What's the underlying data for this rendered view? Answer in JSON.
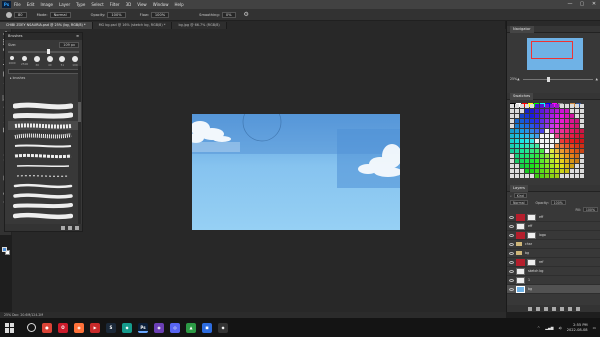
{
  "app": {
    "menu": [
      "File",
      "Edit",
      "Image",
      "Layer",
      "Type",
      "Select",
      "Filter",
      "3D",
      "View",
      "Window",
      "Help"
    ],
    "window_controls": [
      "—",
      "▢",
      "✕"
    ]
  },
  "options_bar": {
    "brush_size": "80",
    "mode_label": "Mode:",
    "mode_value": "Normal",
    "opacity_label": "Opacity:",
    "opacity_value": "100%",
    "flow_label": "Flow:",
    "flow_value": "100%",
    "smoothing_label": "Smoothing:",
    "smoothing_value": "0%"
  },
  "tabs": [
    {
      "label": "CHIBI ZOEY NSAURIA.psd @ 25% (bg, RGB/8) *",
      "active": true
    },
    {
      "label": "MG bg.psd @ 16% (sketch bg, RGB/8) *",
      "active": false
    },
    {
      "label": "bg.jpg @ 66.7% (RGB/8)",
      "active": false
    }
  ],
  "brushes_panel": {
    "title": "Brushes",
    "size_label": "Size:",
    "size_value": "109 px",
    "tips": [
      "1000",
      "2500",
      "30",
      "40",
      "51",
      "100"
    ],
    "group_label": "brushes",
    "selected_index": 2
  },
  "navigator": {
    "title": "Navigator",
    "zoom": "25%"
  },
  "swatches": {
    "title": "Swatches",
    "strip": [
      "#000000",
      "#ffffff",
      "#ff0000",
      "#ffff00",
      "#00ff00",
      "#00ffff",
      "#0000ff",
      "#ff00ff",
      "#888888",
      "#444444",
      "#cc8844",
      "#335599"
    ]
  },
  "layers": {
    "title": "Layers",
    "kind_label": "Kind",
    "blend_mode": "Normal",
    "opacity_label": "Opacity:",
    "opacity_value": "100%",
    "fill_label": "Fill:",
    "fill_value": "100%",
    "items": [
      {
        "name": "eff",
        "thumb": "white",
        "red": true,
        "visible": true,
        "active": false
      },
      {
        "name": "eff",
        "thumb": "white",
        "red": false,
        "visible": true,
        "active": false
      },
      {
        "name": "logo",
        "thumb": "white",
        "red": true,
        "visible": true,
        "active": false
      },
      {
        "name": "char",
        "thumb": "folder",
        "red": false,
        "visible": true,
        "active": false
      },
      {
        "name": "bg",
        "thumb": "folder",
        "red": false,
        "visible": true,
        "active": false
      },
      {
        "name": "ref",
        "thumb": "white",
        "red": true,
        "visible": true,
        "active": false
      },
      {
        "name": "sketch bg",
        "thumb": "white",
        "red": false,
        "visible": true,
        "active": false
      },
      {
        "name": "1",
        "thumb": "white",
        "red": false,
        "visible": true,
        "active": false
      },
      {
        "name": "bg",
        "thumb": "sky",
        "red": false,
        "visible": true,
        "active": true
      }
    ]
  },
  "status": {
    "text": "25%     Doc: 20.6M/124.2M"
  },
  "taskbar": {
    "apps": [
      {
        "name": "chrome",
        "color": "#db4437",
        "glyph": "●"
      },
      {
        "name": "opera",
        "color": "#cc1b2b",
        "glyph": "O"
      },
      {
        "name": "firefox",
        "color": "#ff7139",
        "glyph": "◉"
      },
      {
        "name": "app-red",
        "color": "#c82a2a",
        "glyph": "▶"
      },
      {
        "name": "steam",
        "color": "#1b2838",
        "glyph": "S"
      },
      {
        "name": "app-teal",
        "color": "#159b8c",
        "glyph": "◆"
      },
      {
        "name": "photoshop",
        "color": "#0b1f3a",
        "glyph": "Ps"
      },
      {
        "name": "app-purple",
        "color": "#6b3fb5",
        "glyph": "◉"
      },
      {
        "name": "discord",
        "color": "#5865f2",
        "glyph": "◎"
      },
      {
        "name": "app-green",
        "color": "#2c9a45",
        "glyph": "▲"
      },
      {
        "name": "app-blue",
        "color": "#2d6cdf",
        "glyph": "◼"
      },
      {
        "name": "app-dark",
        "color": "#333333",
        "glyph": "◆"
      }
    ],
    "clock_time": "2:55 PM",
    "clock_date": "2022-08-08"
  }
}
